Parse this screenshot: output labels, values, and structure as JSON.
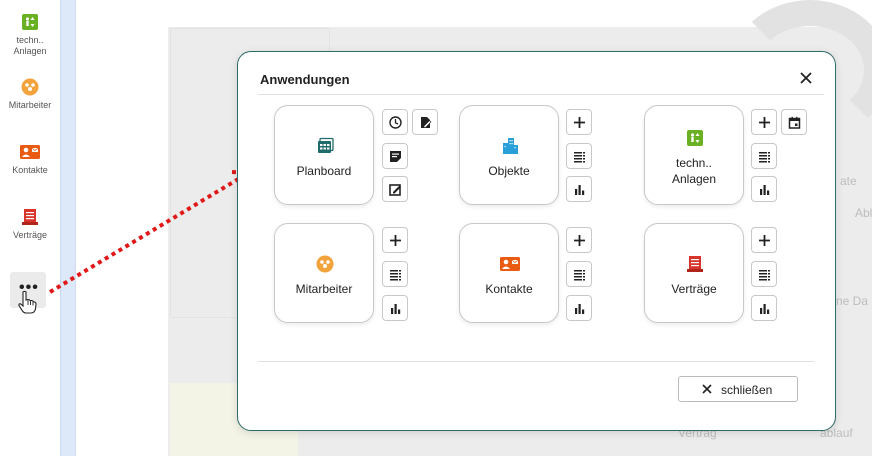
{
  "sidebar": {
    "items": [
      {
        "label_line1": "techn..",
        "label_line2": "Anlagen",
        "icon": "technical-equipment-icon",
        "color": "#6ab023"
      },
      {
        "label": "Mitarbeiter",
        "icon": "employees-icon",
        "color": "#f2a33c"
      },
      {
        "label": "Kontakte",
        "icon": "contacts-icon",
        "color": "#ea5b12"
      },
      {
        "label": "Verträge",
        "icon": "contracts-icon",
        "color": "#d9342b"
      }
    ],
    "more_label": "•••"
  },
  "background": {
    "texts": [
      "ate",
      "Abl",
      "ne Da",
      "Vertrag",
      "ablauf",
      "Vertrag"
    ]
  },
  "dialog": {
    "title": "Anwendungen",
    "close_button_label": "schließen",
    "apps": [
      {
        "label": "Planboard",
        "icon": "planboard-icon",
        "color": "#1e6b6b",
        "actions": [
          "clock-icon",
          "edit-document-icon",
          "note-icon",
          "edit-icon"
        ]
      },
      {
        "label": "Objekte",
        "icon": "buildings-icon",
        "color": "#2aa0d8",
        "actions": [
          "plus-icon",
          "list-icon",
          "bar-chart-icon"
        ]
      },
      {
        "label_line1": "techn..",
        "label_line2": "Anlagen",
        "icon": "technical-equipment-icon",
        "color": "#6ab023",
        "actions": [
          "plus-icon",
          "calendar-icon",
          "list-icon",
          "bar-chart-icon"
        ]
      },
      {
        "label": "Mitarbeiter",
        "icon": "employees-icon",
        "color": "#f2a33c",
        "actions": [
          "plus-icon",
          "list-icon",
          "bar-chart-icon"
        ]
      },
      {
        "label": "Kontakte",
        "icon": "contacts-icon",
        "color": "#ea5b12",
        "actions": [
          "plus-icon",
          "list-icon",
          "bar-chart-icon"
        ]
      },
      {
        "label": "Verträge",
        "icon": "contracts-icon",
        "color": "#d9342b",
        "actions": [
          "plus-icon",
          "list-icon",
          "bar-chart-icon"
        ]
      }
    ]
  },
  "colors": {
    "accent": "#2f6a6a",
    "arrow": "#e01818",
    "sidebar_divider": "#dde9f8"
  }
}
